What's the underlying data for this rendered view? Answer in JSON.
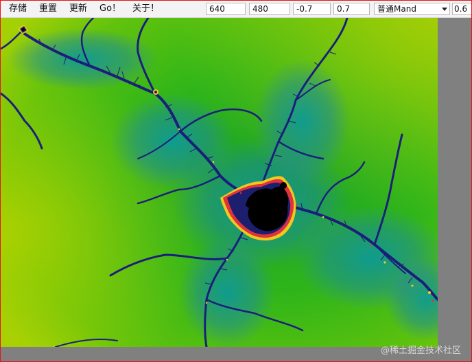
{
  "menu": {
    "save": "存储",
    "reset": "重置",
    "update": "更新",
    "go": "Go！",
    "about": "关于！"
  },
  "inputs": {
    "width": "640",
    "height": "480",
    "center_x": "-0.7",
    "center_y": "0.7",
    "mode": "普通Mand",
    "extra": "0.6"
  },
  "watermark": "@稀土掘金技术社区",
  "colors": {
    "frame_border": "#e31414",
    "background_green": "#33b51a",
    "filament_blue": "#1a1f7a",
    "set_black": "#000000",
    "margin_gray": "#808080"
  },
  "icons": {
    "dropdown": "chevron-down-icon"
  }
}
